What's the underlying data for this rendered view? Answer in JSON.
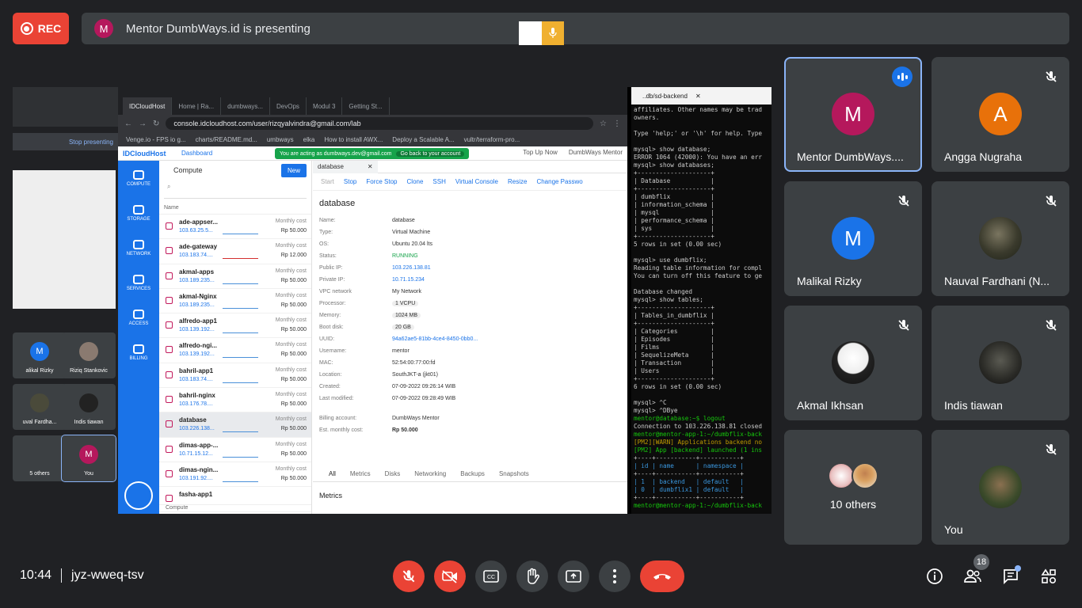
{
  "topbar": {
    "rec_label": "REC",
    "presenter_initial": "M",
    "presenting_text": "Mentor DumbWays.id is presenting",
    "colors": {
      "rec": "#ea4335",
      "presenter_avatar": "#b5185c"
    }
  },
  "shared_screen": {
    "left_strip": {
      "stop_presenting": "Stop presenting",
      "tiles": [
        {
          "name": "alikal Rizky",
          "initial": "M"
        },
        {
          "name": "Riziq Stankovic",
          "initial": ""
        },
        {
          "name": "uval Fardha...",
          "initial": ""
        },
        {
          "name": "Indis tiawan",
          "initial": ""
        },
        {
          "name": "5 others",
          "initial": ""
        },
        {
          "name": "You",
          "initial": "M"
        }
      ]
    },
    "browser": {
      "tabs": [
        "IDCloudHost",
        "Home | Ra...",
        "dumbways...",
        "DevOps",
        "Modul 3",
        "Getting St..."
      ],
      "url": "console.idcloudhost.com/user/rizqyalvindra@gmail.com/lab",
      "bookmarks": [
        "Venge.io - FPS io g...",
        "charts/README.md...",
        "umbways",
        "elka",
        "How to install AWX...",
        "Deploy a Scalable A...",
        "vultr/terraform-pro..."
      ],
      "app": {
        "logo": "IDCloudHost",
        "dashboard": "Dashboard",
        "acting_text": "You are acting as dumbways.dev@gmail.com",
        "acting_button": "Go back to your account",
        "topup": "Top Up Now",
        "account": "DumbWays Mentor"
      },
      "rail": [
        "COMPUTE",
        "STORAGE",
        "NETWORK",
        "SERVICES",
        "ACCESS",
        "BILLING"
      ],
      "list": {
        "title": "Compute",
        "new_button": "New",
        "column": "Name",
        "footer": "Compute",
        "cost_label": "Monthly cost",
        "rows": [
          {
            "name": "ade-appser...",
            "ip": "103.63.25.5...",
            "price": "Rp 50.000",
            "bar": "blue"
          },
          {
            "name": "ade-gateway",
            "ip": "103.183.74....",
            "price": "Rp 12.000",
            "bar": "red"
          },
          {
            "name": "akmal-apps",
            "ip": "103.189.235...",
            "price": "Rp 50.000",
            "bar": "blue"
          },
          {
            "name": "akmal-Nginx",
            "ip": "103.189.235...",
            "price": "Rp 50.000",
            "bar": "blue"
          },
          {
            "name": "alfredo-app1",
            "ip": "103.139.192...",
            "price": "Rp 50.000",
            "bar": "blue"
          },
          {
            "name": "alfredo-ngi...",
            "ip": "103.139.192...",
            "price": "Rp 50.000",
            "bar": "blue"
          },
          {
            "name": "bahril-app1",
            "ip": "103.183.74....",
            "price": "Rp 50.000",
            "bar": "blue"
          },
          {
            "name": "bahril-nginx",
            "ip": "103.176.78....",
            "price": "Rp 50.000",
            "bar": "none"
          },
          {
            "name": "database",
            "ip": "103.226.138...",
            "price": "Rp 50.000",
            "bar": "blue"
          },
          {
            "name": "dimas-app-...",
            "ip": "10.71.15.12...",
            "price": "Rp 50.000",
            "bar": "blue"
          },
          {
            "name": "dimas-ngin...",
            "ip": "103.191.92....",
            "price": "Rp 50.000",
            "bar": "blue"
          },
          {
            "name": "fasha-app1",
            "ip": "",
            "price": "",
            "bar": "none"
          }
        ]
      },
      "detail": {
        "tab": "database",
        "actions": [
          "Start",
          "Stop",
          "Force Stop",
          "Clone",
          "SSH",
          "Virtual Console",
          "Resize",
          "Change Passwo"
        ],
        "title": "database",
        "fields": [
          {
            "k": "Name:",
            "v": "database"
          },
          {
            "k": "Type:",
            "v": "Virtual Machine"
          },
          {
            "k": "OS:",
            "v": "Ubuntu 20.04 lts"
          },
          {
            "k": "Status:",
            "v": "RUNNING"
          },
          {
            "k": "Public IP:",
            "v": "103.226.138.81"
          },
          {
            "k": "Private IP:",
            "v": "10.71.15.234"
          },
          {
            "k": "VPC network",
            "v": "My Network"
          },
          {
            "k": "Processor:",
            "v": "1 VCPU"
          },
          {
            "k": "Memory:",
            "v": "1024 MB"
          },
          {
            "k": "Boot disk:",
            "v": "20 GB"
          },
          {
            "k": "UUID:",
            "v": "94a62ae5-81bb-4ce4-8450-0bb0..."
          },
          {
            "k": "Username:",
            "v": "mentor"
          },
          {
            "k": "MAC:",
            "v": "52:54:00:77:00:fd"
          },
          {
            "k": "Location:",
            "v": "SouthJKT-a (jkt01)"
          },
          {
            "k": "Created:",
            "v": "07-09-2022 09:26:14 WIB"
          },
          {
            "k": "Last modified:",
            "v": "07-09-2022 09:28:49 WIB"
          }
        ],
        "billing": {
          "k": "Billing account:",
          "v": "DumbWays Mentor"
        },
        "est": {
          "k": "Est. monthly cost:",
          "v": "Rp 50.000"
        },
        "tabs": [
          "All",
          "Metrics",
          "Disks",
          "Networking",
          "Backups",
          "Snapshots"
        ],
        "metrics_title": "Metrics"
      }
    },
    "terminal": {
      "tab_title": "..db/sd-backend",
      "lines": [
        "affiliates. Other names may be trad",
        "owners.",
        "",
        "Type 'help;' or '\\h' for help. Type",
        "",
        "mysql> show database;",
        "ERROR 1064 (42000): You have an err",
        "mysql> show databases;",
        "+--------------------+",
        "| Database           |",
        "+--------------------+",
        "| dumbflix           |",
        "| information_schema |",
        "| mysql              |",
        "| performance_schema |",
        "| sys                |",
        "+--------------------+",
        "5 rows in set (0.00 sec)",
        "",
        "mysql> use dumbflix;",
        "Reading table information for compl",
        "You can turn off this feature to ge",
        "",
        "Database changed",
        "mysql> show tables;",
        "+--------------------+",
        "| Tables_in_dumbflix |",
        "+--------------------+",
        "| Categories         |",
        "| Episodes           |",
        "| Films              |",
        "| SequelizeMeta      |",
        "| Transaction        |",
        "| Users              |",
        "+--------------------+",
        "6 rows in set (0.00 sec)",
        "",
        "mysql> ^C",
        "mysql> ^DBye",
        "mentor@database:~$ logout",
        "Connection to 103.226.138.81 closed",
        "mentor@mentor-app-1:~/dumbflix-back",
        "[PM2][WARN] Applications backend no",
        "[PM2] App [backend] launched (1 ins",
        "+----+-----------+-----------+",
        "| id | name      | namespace |",
        "+----+-----------+-----------+",
        "| 1  | backend   | default   |",
        "| 0  | dumbflix1 | default   |",
        "+----+-----------+-----------+",
        "mentor@mentor-app-1:~/dumbflix-back"
      ]
    }
  },
  "participants": [
    {
      "name": "Mentor DumbWays....",
      "initial": "M",
      "color": "#b5185c",
      "state": "speaking"
    },
    {
      "name": "Angga Nugraha",
      "initial": "A",
      "color": "#e8710a",
      "state": "muted"
    },
    {
      "name": "Malikal Rizky",
      "initial": "M",
      "color": "#1a73e8",
      "state": "muted"
    },
    {
      "name": "Nauval Fardhani (N...",
      "initial": "",
      "color": "",
      "state": "muted"
    },
    {
      "name": "Akmal Ikhsan",
      "initial": "",
      "color": "",
      "state": "muted"
    },
    {
      "name": "Indis tiawan",
      "initial": "",
      "color": "",
      "state": "muted"
    },
    {
      "name": "10 others",
      "initial": "",
      "color": "",
      "state": "group"
    },
    {
      "name": "You",
      "initial": "",
      "color": "",
      "state": "muted"
    }
  ],
  "bottombar": {
    "time": "10:44",
    "meeting_code": "jyz-wweq-tsv",
    "people_count": "18"
  }
}
